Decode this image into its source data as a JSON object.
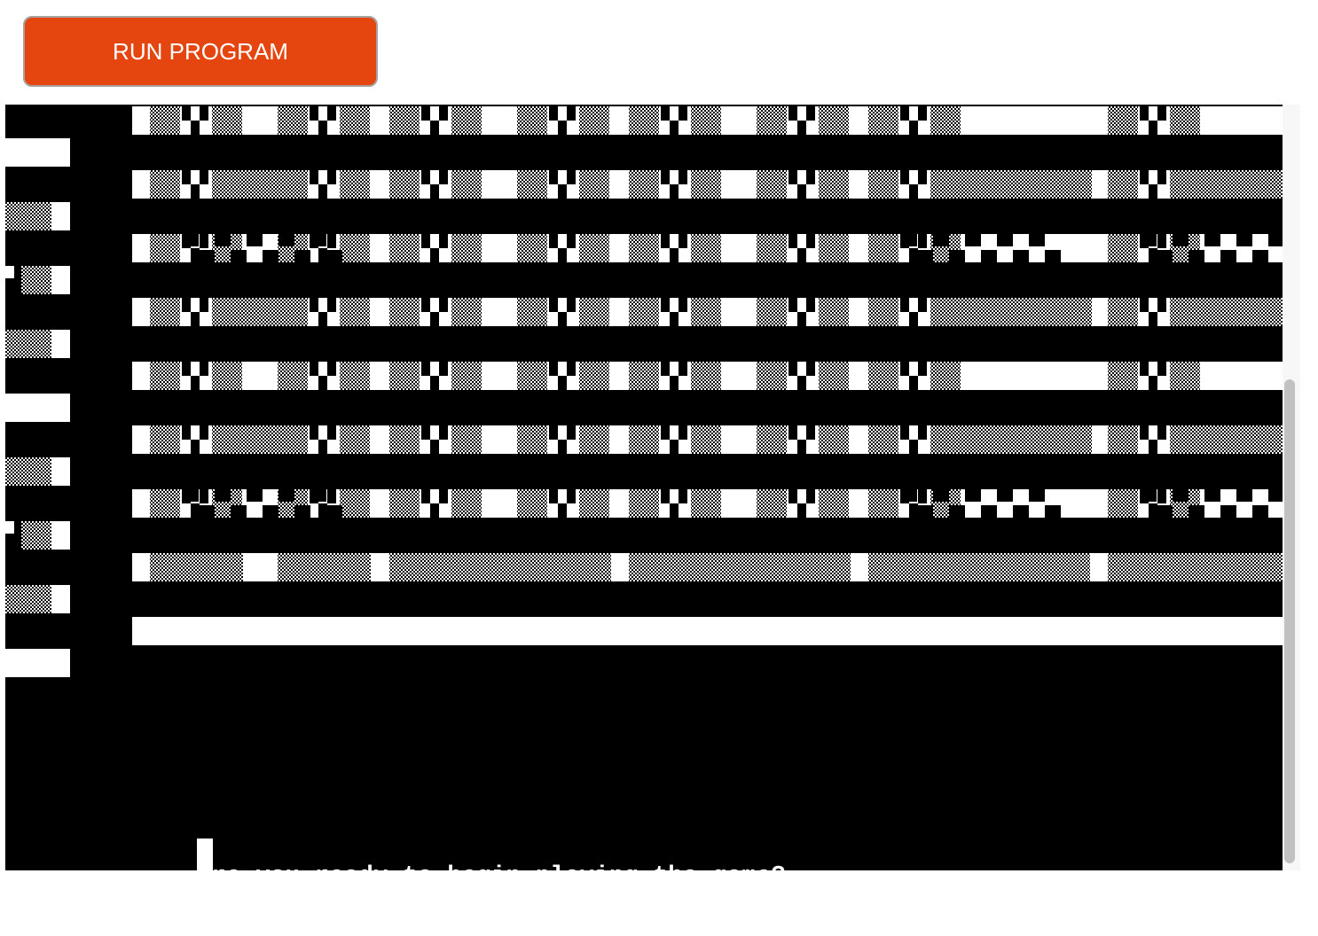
{
  "toolbar": {
    "run_button_label": "RUN PROGRAM",
    "run_button_color": "#e5450f"
  },
  "terminal": {
    "background": "#000000",
    "foreground": "#ffffff",
    "prompt_text": "Are you ready to begin playing the game?",
    "cursor_icon": "block-cursor-icon"
  },
  "art": {
    "description_icon": "dithered-block-pattern-icon",
    "rows": 8
  }
}
